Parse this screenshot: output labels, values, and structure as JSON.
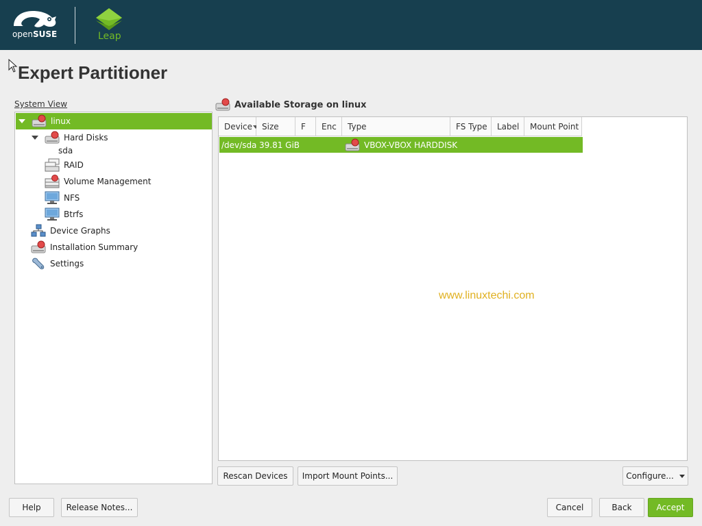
{
  "header": {
    "brand_open": "open",
    "brand_suse": "SUSE",
    "product": "Leap",
    "bg_color": "#173f4f",
    "accent_color": "#73ba25"
  },
  "page": {
    "title": "Expert Partitioner"
  },
  "system_view": {
    "label": "System View",
    "items": [
      {
        "label": "linux",
        "icon": "hard-disk-icon",
        "selected": true
      },
      {
        "label": "Hard Disks",
        "icon": "hard-disk-icon"
      },
      {
        "label": "sda"
      },
      {
        "label": "RAID",
        "icon": "raid-icon"
      },
      {
        "label": "Volume Management",
        "icon": "volume-icon"
      },
      {
        "label": "NFS",
        "icon": "network-monitor-icon"
      },
      {
        "label": "Btrfs",
        "icon": "monitor-icon"
      },
      {
        "label": "Device Graphs",
        "icon": "device-graph-icon"
      },
      {
        "label": "Installation Summary",
        "icon": "hard-disk-icon"
      },
      {
        "label": "Settings",
        "icon": "wrench-icon"
      }
    ]
  },
  "storage": {
    "title": "Available Storage on linux",
    "columns": [
      "Device",
      "Size",
      "F",
      "Enc",
      "Type",
      "FS Type",
      "Label",
      "Mount Point"
    ],
    "rows": [
      {
        "device": "/dev/sda",
        "size": "39.81 GiB",
        "f": "",
        "enc": "",
        "type": "VBOX-VBOX HARDDISK",
        "fs_type": "",
        "label": "",
        "mount_point": ""
      }
    ]
  },
  "watermark": "www.linuxtechi.com",
  "buttons": {
    "rescan": "Rescan Devices",
    "import": "Import Mount Points...",
    "configure": "Configure...",
    "help": "Help",
    "release_notes": "Release Notes...",
    "cancel": "Cancel",
    "back": "Back",
    "accept": "Accept"
  }
}
